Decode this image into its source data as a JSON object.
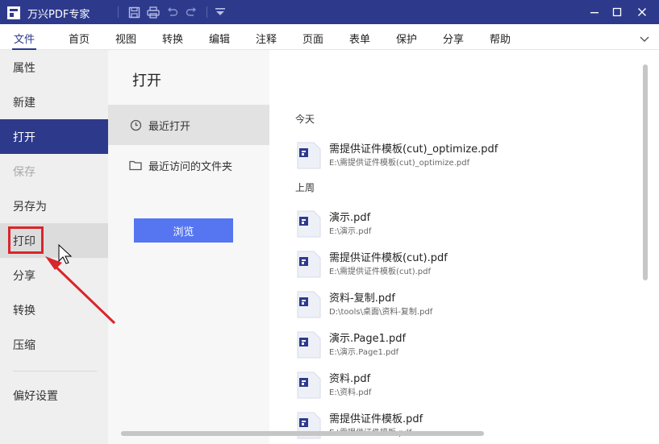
{
  "app": {
    "title": "万兴PDF专家"
  },
  "menu": {
    "items": [
      "文件",
      "首页",
      "视图",
      "转换",
      "编辑",
      "注释",
      "页面",
      "表单",
      "保护",
      "分享",
      "帮助"
    ],
    "active_index": 0
  },
  "sidebar": {
    "items": [
      "属性",
      "新建",
      "打开",
      "保存",
      "另存为",
      "打印",
      "分享",
      "转换",
      "压缩"
    ],
    "settings": "偏好设置",
    "active_index": 2,
    "disabled_index": 3,
    "hover_index": 5
  },
  "open_panel": {
    "title": "打开",
    "recent": "最近打开",
    "recent_folders": "最近访问的文件夹",
    "browse": "浏览"
  },
  "recent_files": {
    "today_label": "今天",
    "last_week_label": "上周",
    "today": [
      {
        "name": "需提供证件模板(cut)_optimize.pdf",
        "path": "E:\\需提供证件模板(cut)_optimize.pdf"
      }
    ],
    "last_week": [
      {
        "name": "演示.pdf",
        "path": "E:\\演示.pdf"
      },
      {
        "name": "需提供证件模板(cut).pdf",
        "path": "E:\\需提供证件模板(cut).pdf"
      },
      {
        "name": "资料-复制.pdf",
        "path": "D:\\tools\\桌面\\资料-复制.pdf"
      },
      {
        "name": "演示.Page1.pdf",
        "path": "E:\\演示.Page1.pdf"
      },
      {
        "name": "资料.pdf",
        "path": "E:\\资料.pdf"
      },
      {
        "name": "需提供证件模板.pdf",
        "path": "E:\\需提供证件模板.pdf"
      }
    ]
  },
  "colors": {
    "brand": "#2d3a8c",
    "browse_button": "#5675f0",
    "annotation_red": "#d9252b"
  }
}
